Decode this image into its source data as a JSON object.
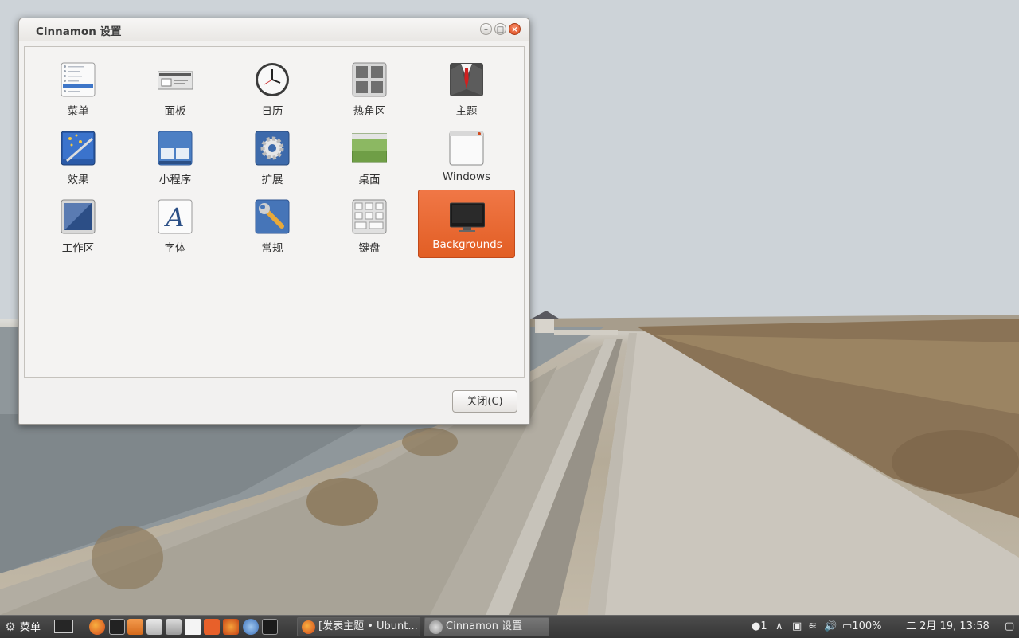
{
  "window": {
    "title": "Cinnamon 设置",
    "close_button_label": "关闭(C)",
    "items": [
      {
        "label": "菜单",
        "icon": "menu-icon"
      },
      {
        "label": "面板",
        "icon": "panel-icon"
      },
      {
        "label": "日历",
        "icon": "clock-icon"
      },
      {
        "label": "热角区",
        "icon": "hot-corner-icon"
      },
      {
        "label": "主题",
        "icon": "suit-icon"
      },
      {
        "label": "效果",
        "icon": "magic-wand-icon"
      },
      {
        "label": "小程序",
        "icon": "applets-icon"
      },
      {
        "label": "扩展",
        "icon": "gear-icon"
      },
      {
        "label": "桌面",
        "icon": "desktop-icon"
      },
      {
        "label": "Windows",
        "icon": "window-icon"
      },
      {
        "label": "工作区",
        "icon": "workspace-icon"
      },
      {
        "label": "字体",
        "icon": "font-icon"
      },
      {
        "label": "常规",
        "icon": "wrench-icon"
      },
      {
        "label": "键盘",
        "icon": "keyboard-icon"
      },
      {
        "label": "Backgrounds",
        "icon": "monitor-icon",
        "selected": true
      }
    ],
    "selection_color": "#e8672f"
  },
  "taskbar": {
    "menu_label": "菜单",
    "tasks": [
      {
        "label": "[发表主题 • Ubunt...",
        "icon": "firefox-icon"
      },
      {
        "label": "Cinnamon 设置",
        "icon": "settings-icon",
        "active": true
      }
    ],
    "tray": {
      "notifications": "1",
      "battery": "100%",
      "clock": "二 2月 19, 13:58"
    }
  }
}
